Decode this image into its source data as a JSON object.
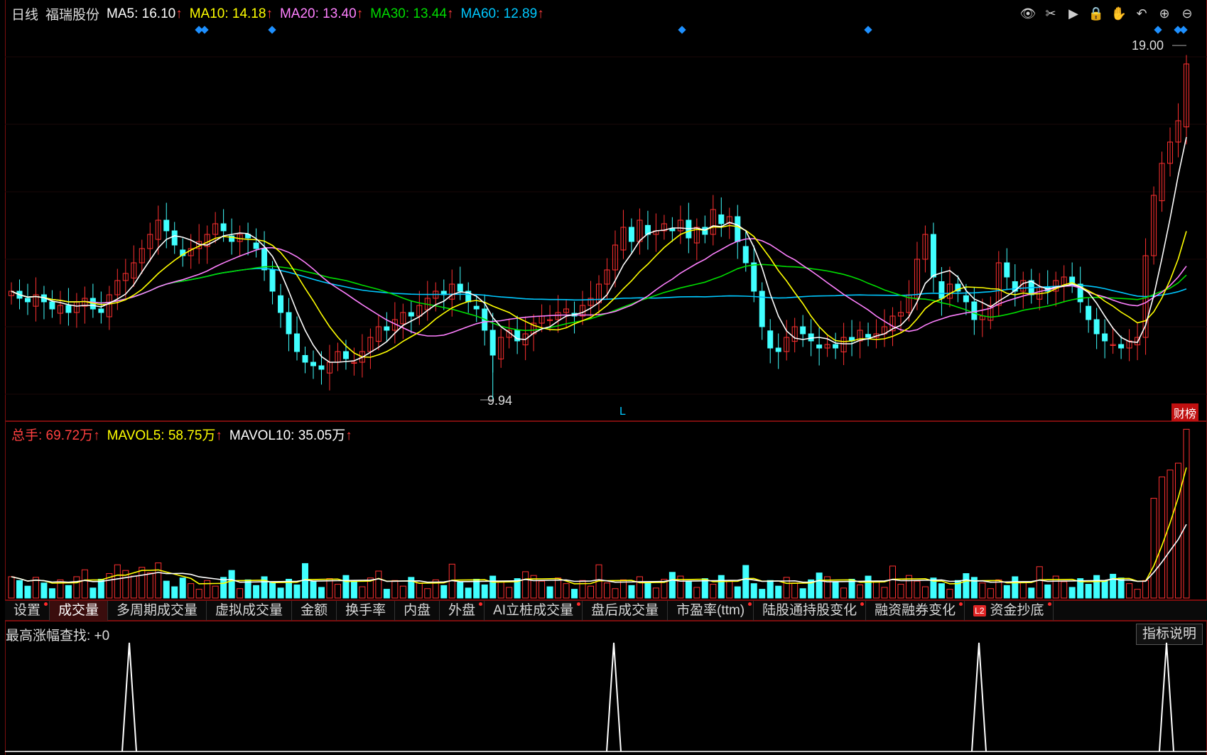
{
  "main_legend": {
    "period": "日线",
    "stock_name": "福瑞股份",
    "ma5": "MA5: 16.10",
    "ma10": "MA10: 14.18",
    "ma20": "MA20: 13.40",
    "ma30": "MA30: 13.44",
    "ma60": "MA60: 12.89",
    "up_arrow": "↑"
  },
  "colors": {
    "ma5": "#ffffff",
    "ma10": "#ffff00",
    "ma20": "#ff80ff",
    "ma30": "#00dd00",
    "ma60": "#00c8ff",
    "up": "#ff3030",
    "down": "#40ffff",
    "border": "#7a0e0e"
  },
  "toolbar_icons": [
    "eye-icon",
    "scissors-icon",
    "play-icon",
    "lock-icon",
    "hand-icon",
    "undo-icon",
    "zoom-in-icon",
    "zoom-out-icon"
  ],
  "price_labels": {
    "high": "19.00",
    "low": "9.94",
    "marker_L": "L",
    "badge": "财榜"
  },
  "volume_legend": {
    "total": "总手: 69.72万",
    "mavol5": "MAVOL5: 58.75万",
    "mavol10": "MAVOL10: 35.05万",
    "up_arrow": "↑"
  },
  "tabs": [
    "设置",
    "成交量",
    "多周期成交量",
    "虚拟成交量",
    "金额",
    "换手率",
    "内盘",
    "外盘",
    "AI立桩成交量",
    "盘后成交量",
    "市盈率(ttm)",
    "陆股通持股变化",
    "融资融券变化",
    "资金抄底"
  ],
  "active_tab": "成交量",
  "tabs_with_dot": [
    "设置",
    "外盘",
    "AI立桩成交量",
    "市盈率(ttm)",
    "陆股通持股变化",
    "融资融券变化",
    "资金抄底"
  ],
  "l2_badge": "L2",
  "indicator": {
    "label": "最高涨幅查找: +0",
    "button": "指标说明"
  },
  "chart_data": {
    "type": "candlestick",
    "price_high": 19.0,
    "price_low": 9.94,
    "closes": [
      12.6,
      12.4,
      12.3,
      12.5,
      12.3,
      12.1,
      12.2,
      12.0,
      12.3,
      12.4,
      12.1,
      12.0,
      12.5,
      12.9,
      13.1,
      13.4,
      13.8,
      14.2,
      14.6,
      14.3,
      13.9,
      13.6,
      13.8,
      14.0,
      14.2,
      14.5,
      14.3,
      14.0,
      14.2,
      14.1,
      13.8,
      13.2,
      12.6,
      12.0,
      11.4,
      10.9,
      10.6,
      10.5,
      10.4,
      10.6,
      10.9,
      10.7,
      10.6,
      10.9,
      11.3,
      11.6,
      11.5,
      11.8,
      12.0,
      11.9,
      12.2,
      12.4,
      12.6,
      12.5,
      12.8,
      12.6,
      12.3,
      12.1,
      11.5,
      10.8,
      11.3,
      11.5,
      11.2,
      11.4,
      11.7,
      11.9,
      11.8,
      12.0,
      12.1,
      11.9,
      12.2,
      12.4,
      12.8,
      13.2,
      13.9,
      14.4,
      14.0,
      14.6,
      14.2,
      14.3,
      14.5,
      14.3,
      14.6,
      14.1,
      14.4,
      14.2,
      14.9,
      14.5,
      14.7,
      14.0,
      13.4,
      12.6,
      11.6,
      11.0,
      10.9,
      11.3,
      11.6,
      11.4,
      11.2,
      11.0,
      11.1,
      11.0,
      11.3,
      11.2,
      11.5,
      11.3,
      11.4,
      11.6,
      11.9,
      12.0,
      12.5,
      13.5,
      14.2,
      13.0,
      12.4,
      12.8,
      12.6,
      12.3,
      11.8,
      11.9,
      12.2,
      13.4,
      13.0,
      12.6,
      12.9,
      12.5,
      12.7,
      12.6,
      12.9,
      13.0,
      12.8,
      12.3,
      11.8,
      11.4,
      11.2,
      11.1,
      11.0,
      11.2,
      11.3,
      13.6,
      15.3,
      16.2,
      16.8,
      17.4,
      19.0
    ]
  }
}
